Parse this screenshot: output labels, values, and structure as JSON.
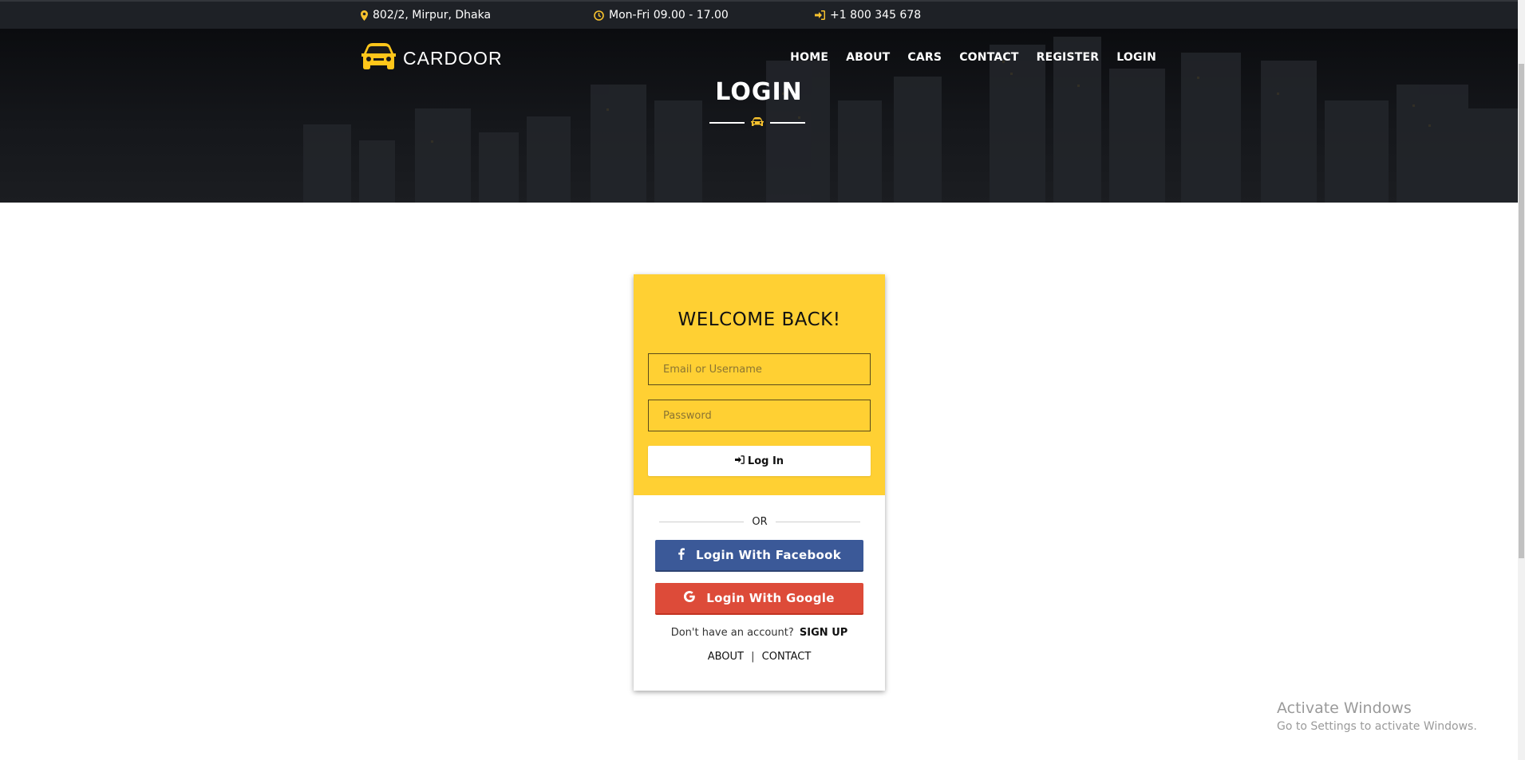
{
  "topbar": {
    "address": "802/2, Mirpur, Dhaka",
    "hours": "Mon-Fri 09.00 - 17.00",
    "phone": "+1 800 345 678",
    "icon_color": "#f7c22e"
  },
  "brand": {
    "name": "CARDOOR",
    "accent": "#ffd033"
  },
  "nav": {
    "items": [
      "HOME",
      "ABOUT",
      "CARS",
      "CONTACT",
      "REGISTER",
      "LOGIN"
    ]
  },
  "hero": {
    "title": "LOGIN"
  },
  "login_card": {
    "heading": "WELCOME BACK!",
    "username_placeholder": "Email or Username",
    "password_placeholder": "Password",
    "login_button": "Log In",
    "or_label": "OR",
    "facebook_button": "Login With Facebook",
    "google_button": "Login With Google",
    "signup_prompt": "Don't have an account?",
    "signup_link": "SIGN UP",
    "footer_links": [
      "ABOUT",
      "CONTACT"
    ],
    "footer_separator": "|"
  },
  "colors": {
    "card_top": "#ffd033",
    "facebook": "#3b5998",
    "google": "#dd4b39",
    "topbar_bg": "#1e2126"
  },
  "watermark": {
    "title": "Activate Windows",
    "subtitle": "Go to Settings to activate Windows."
  }
}
